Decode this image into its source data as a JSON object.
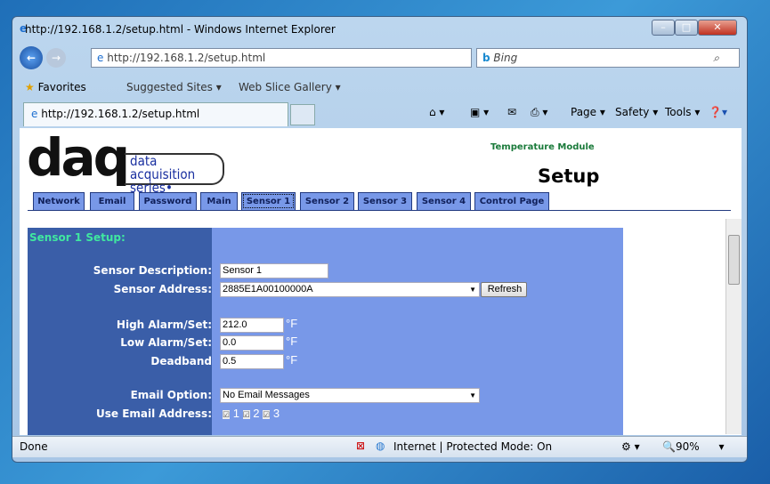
{
  "window": {
    "title": "http://192.168.1.2/setup.html - Windows Internet Explorer"
  },
  "address": {
    "url": "http://192.168.1.2/setup.html",
    "search_placeholder": "Bing"
  },
  "favorites": {
    "label": "Favorites",
    "items": [
      "Suggested Sites",
      "Web Slice Gallery"
    ]
  },
  "tab": {
    "label": "http://192.168.1.2/setup.html"
  },
  "commands": [
    "Page",
    "Safety",
    "Tools"
  ],
  "page": {
    "logo_text": "daq data acquisition series",
    "module": "Temperature Module",
    "heading": "Setup",
    "nav": [
      "Network",
      "Email",
      "Password",
      "Main",
      "Sensor 1",
      "Sensor 2",
      "Sensor 3",
      "Sensor 4",
      "Control Page"
    ],
    "selected_nav": "Sensor 1",
    "section_title": "Sensor 1 Setup:",
    "form": {
      "desc_label": "Sensor Description:",
      "desc_value": "Sensor 1",
      "addr_label": "Sensor Address:",
      "addr_value": "2885E1A00100000A",
      "refresh": "Refresh",
      "high_label": "High Alarm/Set:",
      "high_value": "212.0",
      "low_label": "Low Alarm/Set:",
      "low_value": "0.0",
      "dead_label": "Deadband",
      "dead_value": "0.5",
      "unit": "°F",
      "email_label": "Email Option:",
      "email_value": "No Email Messages",
      "use_label": "Use Email Address:",
      "use_opts": [
        "1",
        "2",
        "3"
      ]
    }
  },
  "status": {
    "text": "Done",
    "zone": "Internet | Protected Mode: On",
    "zoom": "90%"
  }
}
